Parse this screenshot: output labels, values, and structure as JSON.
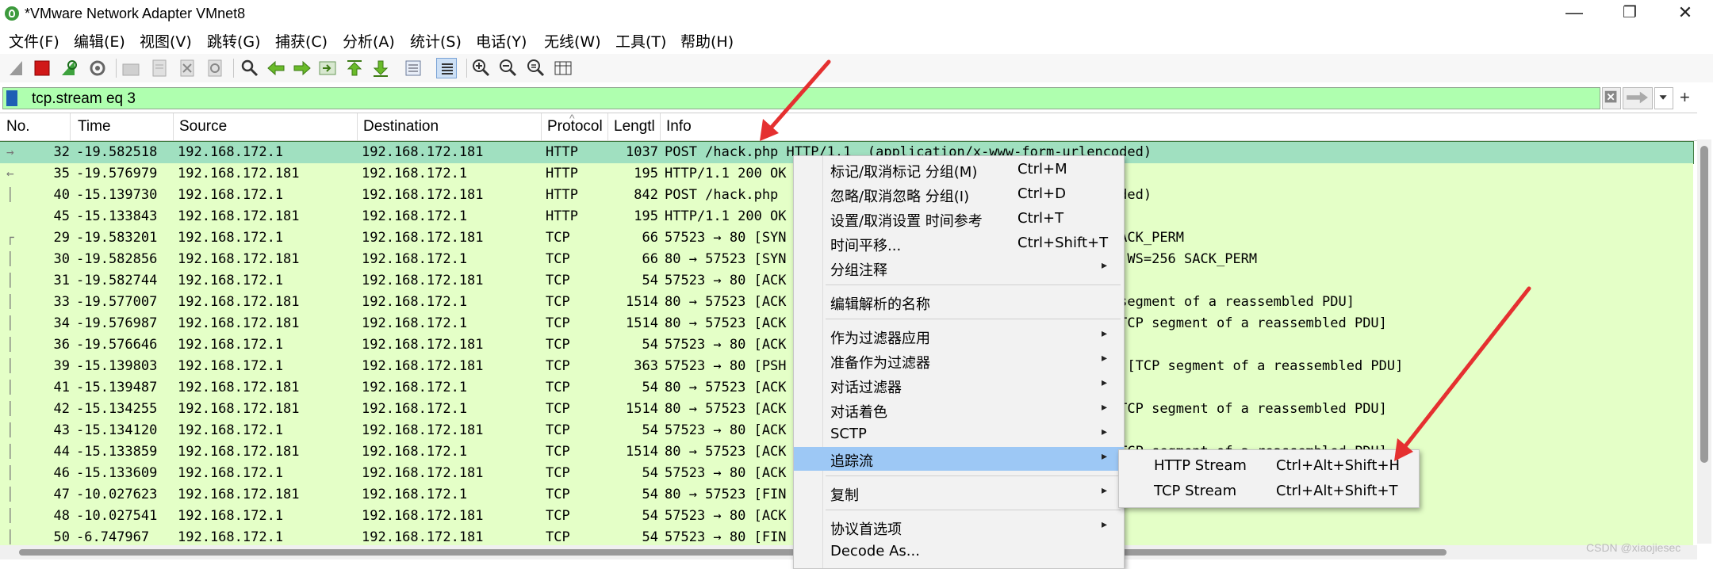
{
  "window": {
    "title": "*VMware Network Adapter VMnet8",
    "minimize": "—",
    "maximize": "❐",
    "close": "✕"
  },
  "menu": [
    "文件(F)",
    "编辑(E)",
    "视图(V)",
    "跳转(G)",
    "捕获(C)",
    "分析(A)",
    "统计(S)",
    "电话(Y)",
    "无线(W)",
    "工具(T)",
    "帮助(H)"
  ],
  "toolbar_icons": [
    "shark-fin-icon",
    "stop-icon",
    "restart-capture-icon",
    "capture-options-icon",
    "open-file-icon",
    "save-file-icon",
    "close-file-icon",
    "reload-icon",
    "find-packet-icon",
    "go-back-icon",
    "go-forward-icon",
    "go-to-packet-icon",
    "go-first-icon",
    "go-last-icon",
    "autoscroll-icon",
    "colorize-icon",
    "zoom-in-icon",
    "zoom-out-icon",
    "zoom-normal-icon",
    "resize-columns-icon"
  ],
  "filter": {
    "value": "tcp.stream eq 3"
  },
  "columns": [
    "No.",
    "Time",
    "Source",
    "Destination",
    "Protocol",
    "Length",
    "Info"
  ],
  "columns_display": {
    "no": "No.",
    "time": "Time",
    "source": "Source",
    "destination": "Destination",
    "protocol": "Protocol",
    "length": "Lengtl",
    "info": "Info"
  },
  "packets": [
    {
      "no": "32",
      "time": "-19.582518",
      "src": "192.168.172.1",
      "dst": "192.168.172.181",
      "proto": "HTTP",
      "len": "1037",
      "info": "POST /hack.php HTTP/1.1  (application/x-www-form-urlencoded)",
      "selected": true,
      "mark": "→"
    },
    {
      "no": "35",
      "time": "-19.576979",
      "src": "192.168.172.181",
      "dst": "192.168.172.1",
      "proto": "HTTP",
      "len": "195",
      "info": "HTTP/1.1 200 OK",
      "mark": "←"
    },
    {
      "no": "40",
      "time": "-15.139730",
      "src": "192.168.172.1",
      "dst": "192.168.172.181",
      "proto": "HTTP",
      "len": "842",
      "info": "POST /hack.php                                        coded)",
      "mark": "│"
    },
    {
      "no": "45",
      "time": "-15.133843",
      "src": "192.168.172.181",
      "dst": "192.168.172.1",
      "proto": "HTTP",
      "len": "195",
      "info": "HTTP/1.1 200 OK",
      "mark": ""
    },
    {
      "no": "29",
      "time": "-19.583201",
      "src": "192.168.172.1",
      "dst": "192.168.172.181",
      "proto": "TCP",
      "len": "66",
      "info": "57523 → 80 [SYN                                        SACK_PERM",
      "mark": "┌"
    },
    {
      "no": "30",
      "time": "-19.582856",
      "src": "192.168.172.181",
      "dst": "192.168.172.1",
      "proto": "TCP",
      "len": "66",
      "info": "80 → 57523 [SYN                                     1460 WS=256 SACK_PERM",
      "mark": "│"
    },
    {
      "no": "31",
      "time": "-19.582744",
      "src": "192.168.172.1",
      "dst": "192.168.172.181",
      "proto": "TCP",
      "len": "54",
      "info": "57523 → 80 [ACK",
      "mark": "│"
    },
    {
      "no": "33",
      "time": "-19.577007",
      "src": "192.168.172.181",
      "dst": "192.168.172.1",
      "proto": "TCP",
      "len": "1514",
      "info": "80 → 57523 [ACK                                      CP segment of a reassembled PDU]",
      "mark": "│"
    },
    {
      "no": "34",
      "time": "-19.576987",
      "src": "192.168.172.181",
      "dst": "192.168.172.1",
      "proto": "TCP",
      "len": "1514",
      "info": "80 → 57523 [ACK                                        [TCP segment of a reassembled PDU]",
      "mark": "│"
    },
    {
      "no": "36",
      "time": "-19.576646",
      "src": "192.168.172.1",
      "dst": "192.168.172.181",
      "proto": "TCP",
      "len": "54",
      "info": "57523 → 80 [ACK",
      "mark": "│"
    },
    {
      "no": "39",
      "time": "-15.139803",
      "src": "192.168.172.1",
      "dst": "192.168.172.181",
      "proto": "TCP",
      "len": "363",
      "info": "57523 → 80 [PSH                                      309 [TCP segment of a reassembled PDU]",
      "mark": "│"
    },
    {
      "no": "41",
      "time": "-15.139487",
      "src": "192.168.172.181",
      "dst": "192.168.172.1",
      "proto": "TCP",
      "len": "54",
      "info": "80 → 57523 [ACK",
      "mark": "│"
    },
    {
      "no": "42",
      "time": "-15.134255",
      "src": "192.168.172.181",
      "dst": "192.168.172.1",
      "proto": "TCP",
      "len": "1514",
      "info": "80 → 57523 [ACK                                      0 [TCP segment of a reassembled PDU]",
      "mark": "│"
    },
    {
      "no": "43",
      "time": "-15.134120",
      "src": "192.168.172.1",
      "dst": "192.168.172.181",
      "proto": "TCP",
      "len": "54",
      "info": "57523 → 80 [ACK",
      "mark": "│"
    },
    {
      "no": "44",
      "time": "-15.133859",
      "src": "192.168.172.181",
      "dst": "192.168.172.1",
      "proto": "TCP",
      "len": "1514",
      "info": "80 → 57523 [ACK                                      0 [TCP segment of a reassembled PDU]",
      "mark": "│"
    },
    {
      "no": "46",
      "time": "-15.133609",
      "src": "192.168.172.1",
      "dst": "192.168.172.181",
      "proto": "TCP",
      "len": "54",
      "info": "57523 → 80 [ACK",
      "mark": "│"
    },
    {
      "no": "47",
      "time": "-10.027623",
      "src": "192.168.172.181",
      "dst": "192.168.172.1",
      "proto": "TCP",
      "len": "54",
      "info": "80 → 57523 [FIN",
      "mark": "│"
    },
    {
      "no": "48",
      "time": "-10.027541",
      "src": "192.168.172.1",
      "dst": "192.168.172.181",
      "proto": "TCP",
      "len": "54",
      "info": "57523 → 80 [ACK",
      "mark": "│"
    },
    {
      "no": "50",
      "time": "-6.747967",
      "src": "192.168.172.1",
      "dst": "192.168.172.181",
      "proto": "TCP",
      "len": "54",
      "info": "57523 → 80 [FIN                                      =0",
      "mark": "│"
    }
  ],
  "context_menu": [
    {
      "label": "标记/取消标记 分组(M)",
      "shortcut": "Ctrl+M",
      "arrow": false
    },
    {
      "label": "忽略/取消忽略 分组(I)",
      "shortcut": "Ctrl+D",
      "arrow": false
    },
    {
      "label": "设置/取消设置 时间参考",
      "shortcut": "Ctrl+T",
      "arrow": false
    },
    {
      "label": "时间平移...",
      "shortcut": "Ctrl+Shift+T",
      "arrow": false
    },
    {
      "label": "分组注释",
      "shortcut": "",
      "arrow": true
    },
    {
      "sep": true
    },
    {
      "label": "编辑解析的名称",
      "shortcut": "",
      "arrow": false
    },
    {
      "sep": true
    },
    {
      "label": "作为过滤器应用",
      "shortcut": "",
      "arrow": true
    },
    {
      "label": "准备作为过滤器",
      "shortcut": "",
      "arrow": true
    },
    {
      "label": "对话过滤器",
      "shortcut": "",
      "arrow": true
    },
    {
      "label": "对话着色",
      "shortcut": "",
      "arrow": true
    },
    {
      "label": "SCTP",
      "shortcut": "",
      "arrow": true
    },
    {
      "label": "追踪流",
      "shortcut": "",
      "arrow": true,
      "active": true
    },
    {
      "sep": true
    },
    {
      "label": "复制",
      "shortcut": "",
      "arrow": true
    },
    {
      "sep": true
    },
    {
      "label": "协议首选项",
      "shortcut": "",
      "arrow": true
    },
    {
      "label": "Decode As...",
      "shortcut": "",
      "arrow": false
    }
  ],
  "submenu": [
    {
      "label": "HTTP Stream",
      "shortcut": "Ctrl+Alt+Shift+H"
    },
    {
      "label": "TCP Stream",
      "shortcut": "Ctrl+Alt+Shift+T"
    }
  ],
  "colors": {
    "filter_bg": "#afffaf",
    "row_bg": "#e4ffc7",
    "selected_row": "#a0e0c0",
    "menu_active": "#9dc8f5",
    "annotation_arrow": "#e53030"
  },
  "watermark": "CSDN @xiaojiesec"
}
